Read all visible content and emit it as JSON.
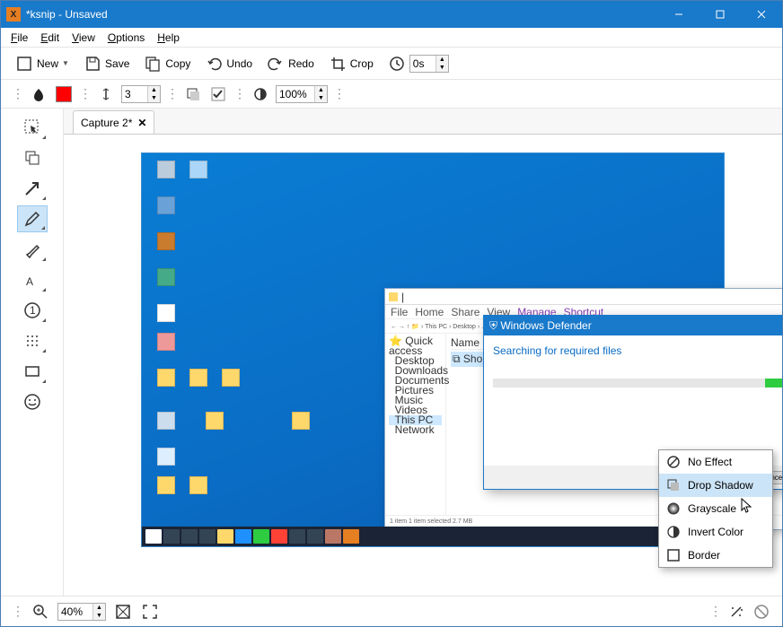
{
  "titlebar": {
    "title": "*ksnip - Unsaved"
  },
  "menus": {
    "file": "File",
    "edit": "Edit",
    "view": "View",
    "options": "Options",
    "help": "Help"
  },
  "toolbar": {
    "new": "New",
    "save": "Save",
    "copy": "Copy",
    "undo": "Undo",
    "redo": "Redo",
    "crop": "Crop",
    "delay_value": "0s"
  },
  "annotbar": {
    "stroke_width": "3",
    "zoom": "100%"
  },
  "tabs": {
    "active": "Capture 2*"
  },
  "statusbar": {
    "zoom": "40%"
  },
  "context_menu": {
    "no_effect": "No Effect",
    "drop_shadow": "Drop Shadow",
    "grayscale": "Grayscale",
    "invert": "Invert Color",
    "border": "Border"
  },
  "capture": {
    "dialog_title": "Windows Defender",
    "dialog_msg": "Searching for required files",
    "dialog_cancel": "Cancel",
    "explorer_status": "1 item    1 item selected  2.7 MB",
    "explorer_tabs": {
      "manage": "Manage",
      "shortcut": "Shortcut"
    }
  }
}
